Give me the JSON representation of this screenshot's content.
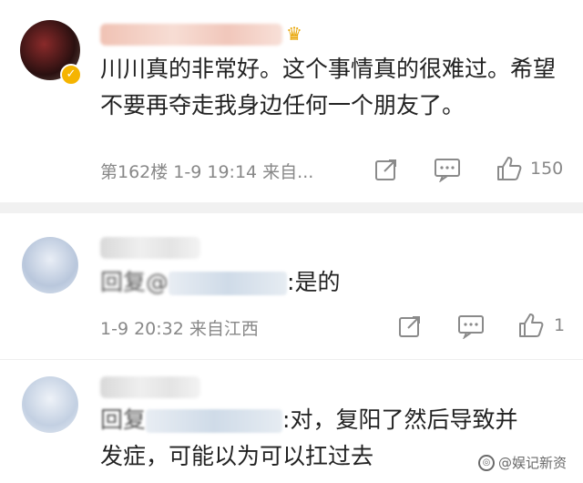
{
  "comments": [
    {
      "text": "川川真的非常好。这个事情真的很难过。希望不要再夺走我身边任何一个朋友了。",
      "meta": "第162楼  1-9 19:14  来自...",
      "like_count": "150"
    },
    {
      "reply_prefix": "回复@",
      "text_tail": ":是的",
      "meta": "1-9 20:32  来自江西",
      "like_count": "1"
    },
    {
      "reply_prefix": "回复",
      "text_tail": ":对，复阳了然后导致并",
      "text_line2": "发症，可能以为可以扛过去"
    }
  ],
  "watermark": {
    "text": "@娱记新资"
  },
  "icons": {
    "verified_badge": "check-badge-icon",
    "crown": "crown-icon",
    "share": "share-icon",
    "comment": "comment-icon",
    "like": "thumbs-up-icon"
  }
}
